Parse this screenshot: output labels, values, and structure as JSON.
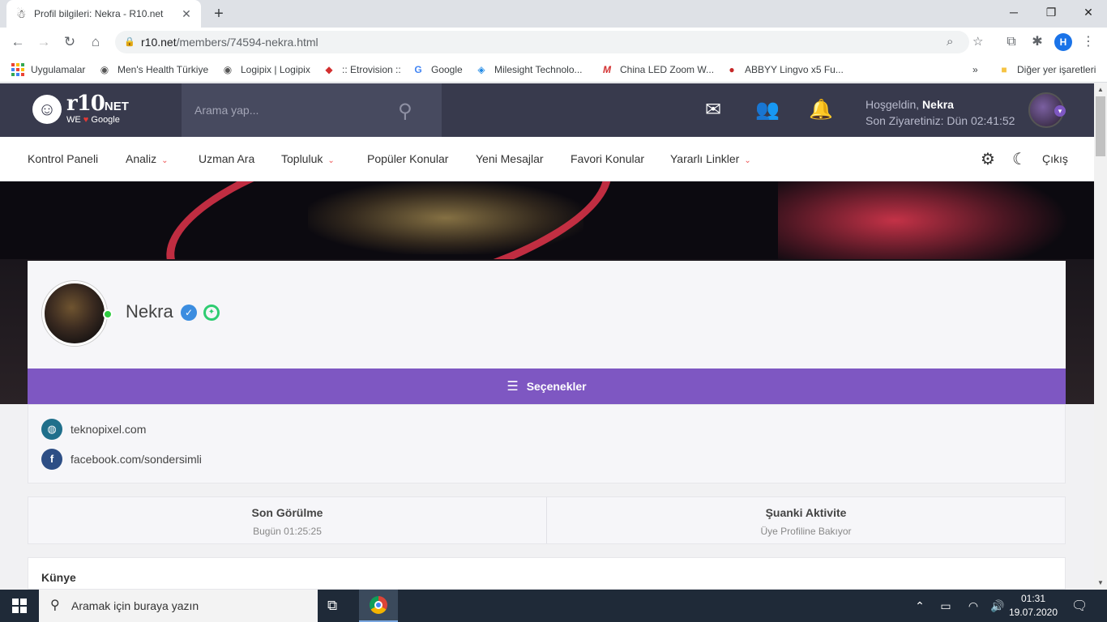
{
  "browser": {
    "tab_title": "Profil bilgileri: Nekra - R10.net",
    "url_host": "r10.net",
    "url_path": "/members/74594-nekra.html",
    "profile_initial": "H",
    "bookmarks": [
      {
        "label": "Uygulamalar",
        "icon": "apps-grid-icon"
      },
      {
        "label": "Men's Health Türkiye",
        "icon": "globe-icon"
      },
      {
        "label": "Logipix | Logipix",
        "icon": "globe-icon"
      },
      {
        "label": ":: Etrovision ::",
        "icon": "etrovision-icon"
      },
      {
        "label": "Google",
        "icon": "google-icon"
      },
      {
        "label": "Milesight Technolo...",
        "icon": "milesight-icon"
      },
      {
        "label": "China LED Zoom W...",
        "icon": "mx-logo-icon"
      },
      {
        "label": "ABBYY Lingvo x5 Fu...",
        "icon": "lingvo-icon"
      }
    ],
    "other_bookmarks": "Diğer yer işaretleri"
  },
  "site": {
    "logo_main": "r10",
    "logo_net": "NET",
    "logo_we": "WE",
    "logo_google": "Google",
    "search_placeholder": "Arama yap...",
    "welcome_prefix": "Hoşgeldin,",
    "welcome_user": "Nekra",
    "last_visit": "Son Ziyaretiniz: Dün 02:41:52",
    "nav": [
      "Kontrol Paneli",
      "Analiz",
      "Uzman Ara",
      "Topluluk",
      "Popüler Konular",
      "Yeni Mesajlar",
      "Favori Konular",
      "Yararlı Linkler"
    ],
    "logout": "Çıkış",
    "colors": {
      "header": "#383a4d",
      "accent": "#7e57c2",
      "online": "#2ecc40"
    }
  },
  "profile": {
    "name": "Nekra",
    "options_label": "Seçenekler",
    "links": [
      "teknopixel.com",
      "facebook.com/sondersimli"
    ],
    "stats": [
      {
        "title": "Son Görülme",
        "value": "Bugün 01:25:25"
      },
      {
        "title": "Şuanki Aktivite",
        "value": "Üye Profiline Bakıyor"
      }
    ],
    "section_title": "Künye"
  },
  "taskbar": {
    "search_placeholder": "Aramak için buraya yazın",
    "time": "01:31",
    "date": "19.07.2020"
  }
}
